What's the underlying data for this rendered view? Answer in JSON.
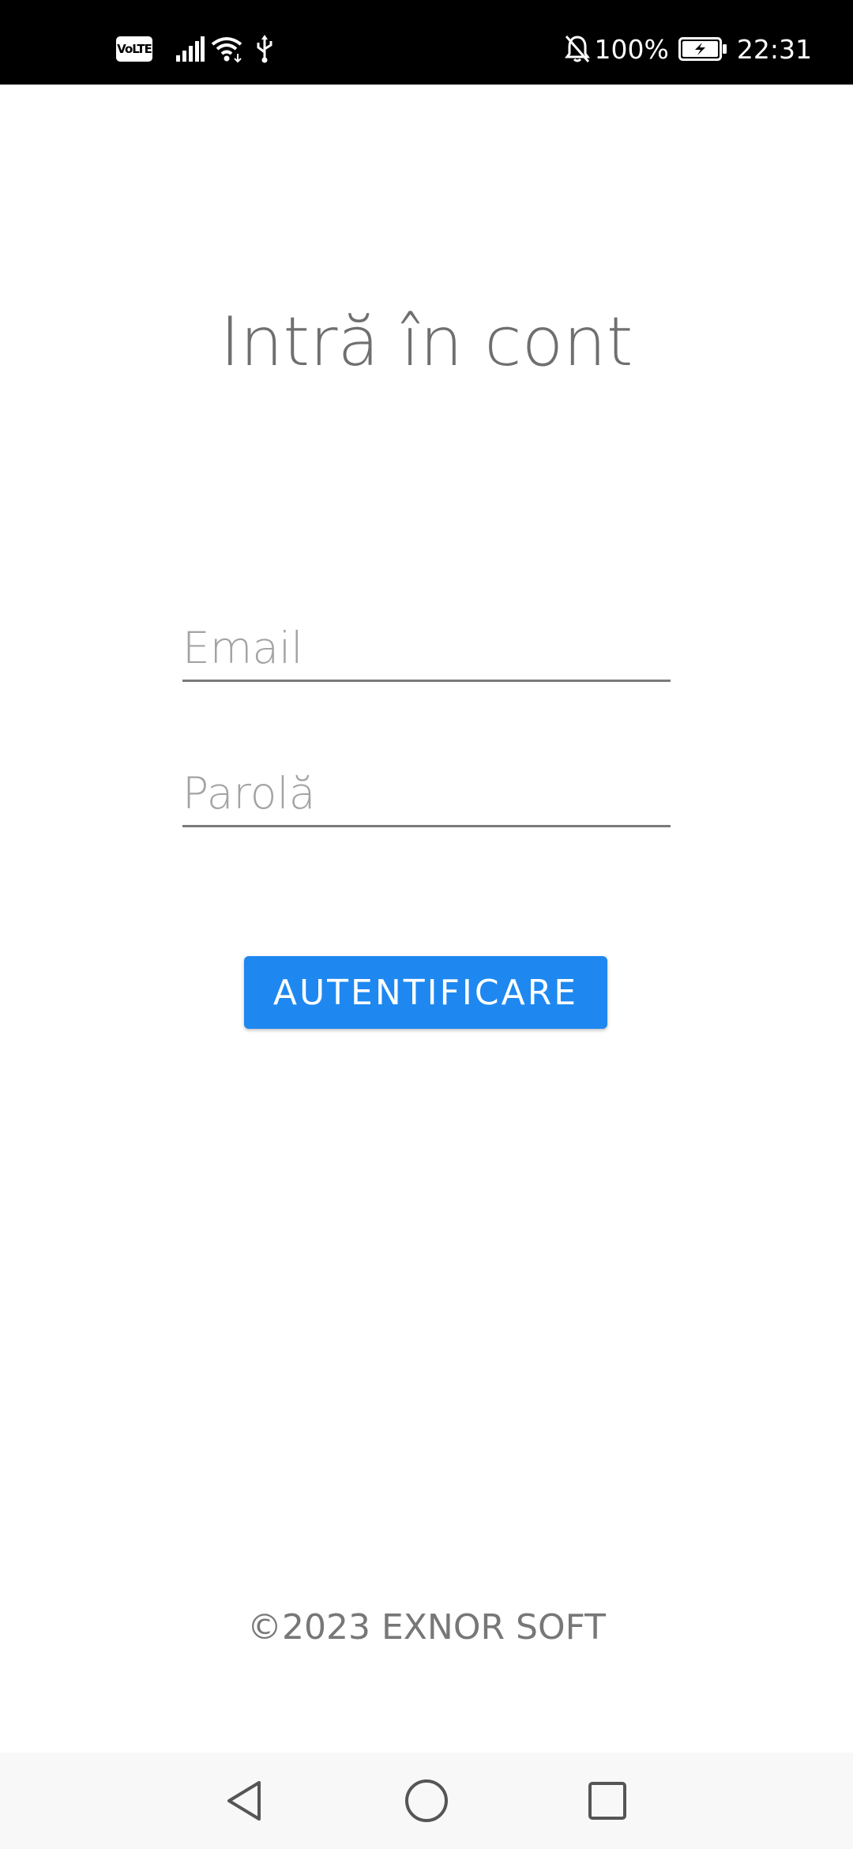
{
  "status_bar": {
    "volte_label": "VoLTE",
    "battery_percent": "100%",
    "time": "22:31",
    "icons": [
      "volte-icon",
      "signal-icon",
      "wifi-icon",
      "usb-icon",
      "notifications-off-icon",
      "battery-charging-icon"
    ]
  },
  "login": {
    "title": "Intră în cont",
    "email_placeholder": "Email",
    "email_value": "",
    "password_placeholder": "Parolă",
    "password_value": "",
    "submit_label": "AUTENTIFICARE"
  },
  "footer": {
    "copyright": "©2023 EXNOR SOFT"
  },
  "nav_bar": {
    "icons": [
      "back-icon",
      "home-icon",
      "recents-icon"
    ]
  },
  "colors": {
    "status_bar_bg": "#000000",
    "primary_button": "#1e88f0",
    "title_text": "#6f6f6f",
    "placeholder_text": "#a3a3a3",
    "nav_bar_bg": "#f8f8f8"
  }
}
